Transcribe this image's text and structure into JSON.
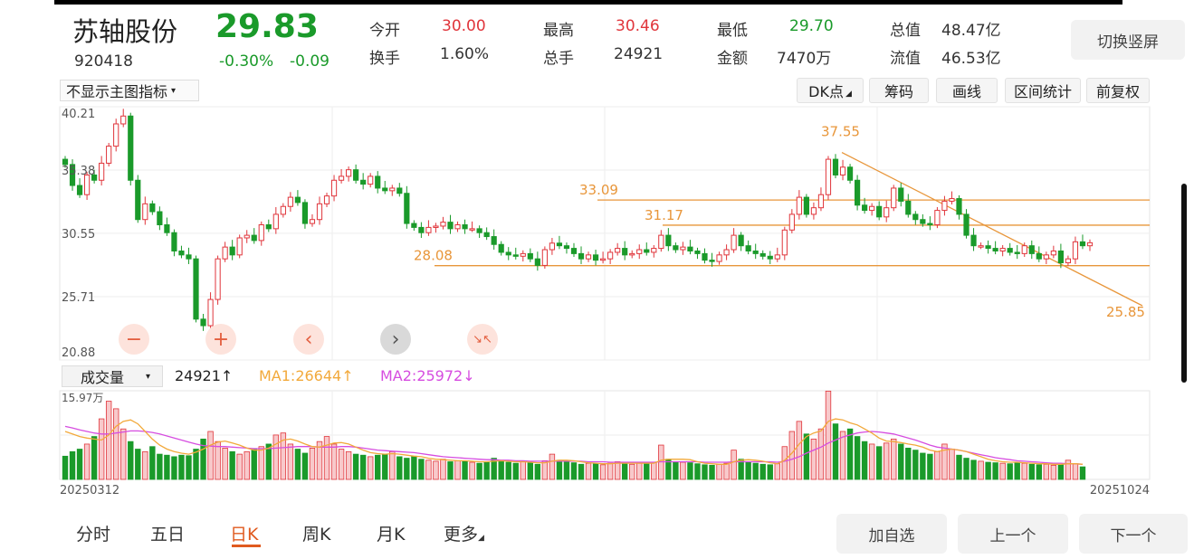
{
  "header": {
    "stock_name": "苏轴股份",
    "price": "29.83",
    "code": "920418",
    "change_pct": "-0.30%",
    "change_amt": "-0.09",
    "stats": [
      {
        "label": "今开",
        "value": "30.00",
        "color": "#e0353b"
      },
      {
        "label": "最高",
        "value": "30.46",
        "color": "#e0353b"
      },
      {
        "label": "最低",
        "value": "29.70",
        "color": "#1a9a2a"
      },
      {
        "label": "总值",
        "value": "48.47亿",
        "color": "#333333"
      },
      {
        "label": "换手",
        "value": "1.60%",
        "color": "#333333"
      },
      {
        "label": "总手",
        "value": "24921",
        "color": "#333333"
      },
      {
        "label": "金额",
        "value": "7470万",
        "color": "#333333"
      },
      {
        "label": "流值",
        "value": "46.53亿",
        "color": "#333333"
      }
    ],
    "switch_label": "切换竖屏"
  },
  "toolbar": {
    "indicator_select": "不显示主图指标",
    "dk_label": "DK点",
    "chip_label": "筹码",
    "draw_label": "画线",
    "range_stat_label": "区间统计",
    "adjust_label": "前复权"
  },
  "controls": {
    "zoom_out": "−",
    "zoom_in": "+",
    "prev": "‹",
    "next": "›",
    "collapse": "↘↖"
  },
  "volume_header": {
    "select": "成交量",
    "vol": "24921↑",
    "ma1": "MA1:26644↑",
    "ma2": "MA2:25972↓"
  },
  "bottom_tabs": [
    {
      "label": "分时",
      "active": false
    },
    {
      "label": "五日",
      "active": false
    },
    {
      "label": "日K",
      "active": true
    },
    {
      "label": "周K",
      "active": false
    },
    {
      "label": "月K",
      "active": false
    },
    {
      "label": "更多",
      "active": false
    }
  ],
  "bottom_buttons": {
    "add_watch": "加自选",
    "prev_stock": "上一个",
    "next_stock": "下一个"
  },
  "colors": {
    "up": "#e0353b",
    "down": "#1a9a2a",
    "line": "#e8963a",
    "ma1": "#f2a93b",
    "ma2": "#d64de0"
  },
  "chart_data": {
    "type": "candlestick",
    "y_ticks": [
      "40.21",
      "35.38",
      "30.55",
      "25.71",
      "20.88"
    ],
    "ylim": [
      20.88,
      40.21
    ],
    "x_start_label": "20250312",
    "x_end_label": "20251024",
    "volume_top_label": "15.97万",
    "volume_max": 159700,
    "annotations": [
      "37.55",
      "33.09",
      "31.17",
      "28.08",
      "25.85"
    ],
    "horizontal_lines": [
      33.09,
      31.17,
      28.08
    ],
    "trend_line": {
      "from": 37.55,
      "to": 25.85
    },
    "closes": [
      35.8,
      34.2,
      33.5,
      35.0,
      34.6,
      35.9,
      37.2,
      38.9,
      39.5,
      34.6,
      31.6,
      32.8,
      32.2,
      31.2,
      30.6,
      29.2,
      28.9,
      28.6,
      24.0,
      23.5,
      25.5,
      28.6,
      29.5,
      28.9,
      30.2,
      30.4,
      30.0,
      31.2,
      30.9,
      32.0,
      32.6,
      33.3,
      32.9,
      31.3,
      31.6,
      32.8,
      33.4,
      34.6,
      34.9,
      35.4,
      34.6,
      34.3,
      34.9,
      34.0,
      33.8,
      34.0,
      33.6,
      31.3,
      31.0,
      30.6,
      31.0,
      31.1,
      31.4,
      30.9,
      31.2,
      30.9,
      30.9,
      30.6,
      30.3,
      29.7,
      29.1,
      28.9,
      28.8,
      29.0,
      28.6,
      28.1,
      29.3,
      29.8,
      29.6,
      29.4,
      29.0,
      28.6,
      28.9,
      28.5,
      28.6,
      29.1,
      29.4,
      28.9,
      29.0,
      29.3,
      29.1,
      29.4,
      30.4,
      29.6,
      29.3,
      29.5,
      29.2,
      29.0,
      28.5,
      28.4,
      28.9,
      29.3,
      30.4,
      29.6,
      29.2,
      29.0,
      28.8,
      28.6,
      28.9,
      30.8,
      32.0,
      33.3,
      32.0,
      32.5,
      33.5,
      36.2,
      35.0,
      35.6,
      34.6,
      32.7,
      32.3,
      32.6,
      31.8,
      32.5,
      34.0,
      33.0,
      32.0,
      31.6,
      31.3,
      31.2,
      32.3,
      33.0,
      33.2,
      32.0,
      30.4,
      29.6,
      29.6,
      29.4,
      29.2,
      29.4,
      29.1,
      29.0,
      29.6,
      29.0,
      28.6,
      28.9,
      29.2,
      28.3,
      28.6,
      29.9,
      29.6,
      29.83
    ],
    "volumes": [
      46000,
      55000,
      60000,
      70000,
      85000,
      120000,
      155000,
      140000,
      100000,
      75000,
      60000,
      55000,
      65000,
      50000,
      48000,
      45000,
      48000,
      47000,
      60000,
      80000,
      95000,
      75000,
      62000,
      55000,
      50000,
      55000,
      60000,
      65000,
      70000,
      88000,
      92000,
      70000,
      60000,
      52000,
      62000,
      75000,
      85000,
      70000,
      60000,
      55000,
      50000,
      48000,
      45000,
      48000,
      50000,
      55000,
      45000,
      42000,
      46000,
      40000,
      38000,
      36000,
      40000,
      35000,
      37000,
      36000,
      34000,
      32000,
      34000,
      42000,
      38000,
      34000,
      32000,
      35000,
      33000,
      30000,
      37000,
      50000,
      38000,
      35000,
      33000,
      30000,
      32000,
      31000,
      29000,
      32000,
      35000,
      31000,
      30000,
      32000,
      31000,
      33000,
      68000,
      40000,
      35000,
      34000,
      33000,
      31000,
      29000,
      28000,
      30000,
      32000,
      58000,
      40000,
      34000,
      32000,
      30000,
      29000,
      31000,
      65000,
      95000,
      115000,
      90000,
      80000,
      100000,
      175000,
      110000,
      95000,
      100000,
      85000,
      75000,
      70000,
      65000,
      72000,
      80000,
      70000,
      62000,
      58000,
      52000,
      50000,
      55000,
      70000,
      60000,
      48000,
      42000,
      38000,
      36000,
      34000,
      33000,
      32000,
      31000,
      34000,
      32000,
      30000,
      29000,
      30000,
      28000,
      29000,
      38000,
      31000,
      24921
    ],
    "ma1": [
      95000,
      90000,
      85000,
      82000,
      80000,
      78000,
      88000,
      105000,
      115000,
      118000,
      110000,
      95000,
      80000,
      68000,
      60000,
      55000,
      52000,
      50000,
      54000,
      60000,
      68000,
      74000,
      76000,
      72000,
      68000,
      62000,
      58000,
      58000,
      62000,
      70000,
      78000,
      80000,
      76000,
      70000,
      65000,
      64000,
      68000,
      72000,
      73000,
      70000,
      64000,
      58000,
      53000,
      51000,
      50000,
      51000,
      50000,
      48000,
      46000,
      45000,
      42000,
      40000,
      39000,
      38000,
      37000,
      37000,
      36000,
      35000,
      35000,
      36000,
      37000,
      36000,
      35000,
      35000,
      34000,
      33000,
      33000,
      36000,
      38000,
      38000,
      37000,
      35000,
      33000,
      32000,
      31000,
      31000,
      32000,
      32000,
      32000,
      32000,
      32000,
      32000,
      38000,
      40000,
      40000,
      40000,
      39000,
      35000,
      32000,
      31000,
      30000,
      30000,
      35000,
      38000,
      39000,
      38000,
      36000,
      33000,
      31000,
      38000,
      52000,
      70000,
      85000,
      92000,
      96000,
      115000,
      120000,
      118000,
      112000,
      108000,
      100000,
      92000,
      82000,
      76000,
      75000,
      73000,
      70000,
      68000,
      64000,
      58000,
      55000,
      58000,
      60000,
      58000,
      55000,
      50000,
      45000,
      40000,
      37000,
      35000,
      34000,
      34000,
      33000,
      32000,
      31000,
      31000,
      30000,
      30000,
      31000,
      31000,
      30000
    ],
    "ma2": [
      105000,
      102000,
      98000,
      95000,
      92000,
      90000,
      90000,
      92000,
      94000,
      96000,
      96000,
      95000,
      93000,
      90000,
      86000,
      82000,
      78000,
      74000,
      70000,
      67000,
      66000,
      65000,
      65000,
      64000,
      63000,
      62000,
      61000,
      61000,
      61000,
      62000,
      63000,
      64000,
      65000,
      65000,
      65000,
      64000,
      64000,
      64000,
      65000,
      65000,
      64000,
      62000,
      60000,
      58000,
      57000,
      56000,
      55000,
      54000,
      53000,
      51000,
      49000,
      47000,
      45000,
      44000,
      43000,
      42000,
      41000,
      40000,
      39000,
      39000,
      38000,
      38000,
      37000,
      37000,
      36000,
      36000,
      36000,
      36000,
      36000,
      36000,
      36000,
      36000,
      35000,
      35000,
      35000,
      34000,
      34000,
      34000,
      34000,
      34000,
      34000,
      34000,
      35000,
      35000,
      35000,
      35000,
      35000,
      35000,
      34000,
      34000,
      34000,
      34000,
      35000,
      35000,
      35000,
      35000,
      35000,
      35000,
      34000,
      36000,
      40000,
      45000,
      52000,
      58000,
      64000,
      72000,
      78000,
      84000,
      88000,
      92000,
      94000,
      95000,
      94000,
      92000,
      90000,
      86000,
      82000,
      78000,
      73000,
      68000,
      64000,
      62000,
      60000,
      58000,
      55000,
      52000,
      49000,
      46000,
      43000,
      41000,
      39000,
      37000,
      36000,
      35000,
      34000,
      33000,
      32000,
      32000,
      31000,
      31000,
      30000
    ]
  }
}
